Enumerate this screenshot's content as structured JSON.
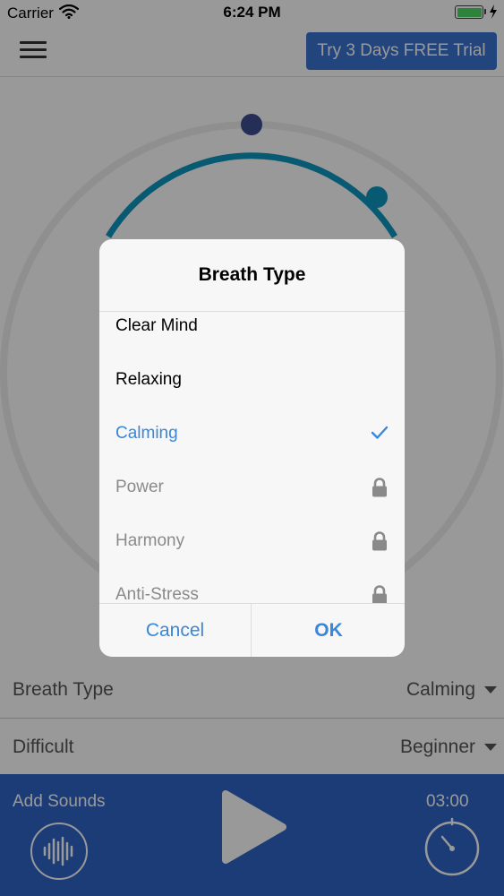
{
  "status_bar": {
    "carrier": "Carrier",
    "time": "6:24 PM"
  },
  "header": {
    "trial_button": "Try 3 Days FREE Trial"
  },
  "settings": {
    "breath_type": {
      "label": "Breath Type",
      "value": "Calming"
    },
    "difficulty": {
      "label": "Difficult",
      "value": "Beginner"
    }
  },
  "bottom_bar": {
    "add_sounds": "Add Sounds",
    "timer": "03:00"
  },
  "dialog": {
    "title": "Breath Type",
    "items": [
      {
        "label": "Clear Mind",
        "state": "available"
      },
      {
        "label": "Relaxing",
        "state": "available"
      },
      {
        "label": "Calming",
        "state": "selected"
      },
      {
        "label": "Power",
        "state": "locked"
      },
      {
        "label": "Harmony",
        "state": "locked"
      },
      {
        "label": "Anti-Stress",
        "state": "locked"
      }
    ],
    "cancel": "Cancel",
    "ok": "OK"
  },
  "colors": {
    "accent": "#3a86d8",
    "primary_bar": "#2f65c6",
    "trial_button": "#3a73d1",
    "dial_ring": "#0e95bf",
    "dial_knob_top": "#3d4d91",
    "locked_text": "#8a8a8a"
  },
  "icons": {
    "wifi": "wifi-icon",
    "battery": "battery-icon",
    "menu": "hamburger-icon",
    "checkmark": "checkmark-icon",
    "lock": "lock-icon",
    "sound_wave": "sound-wave-icon",
    "play": "play-icon",
    "timer": "timer-icon"
  }
}
